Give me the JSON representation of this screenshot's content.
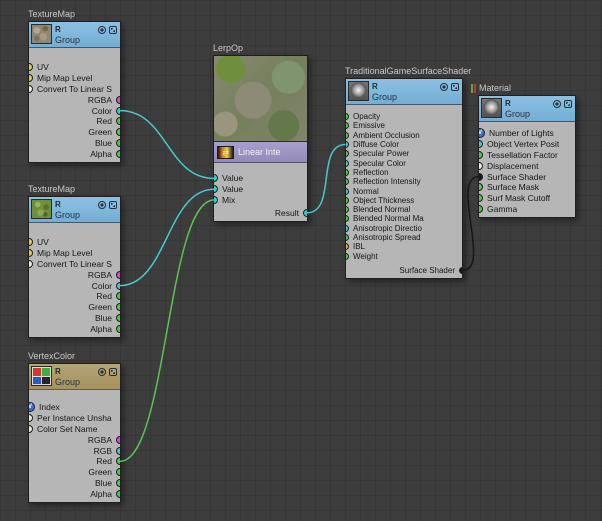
{
  "canvas": {
    "background": "#3d3d3d"
  },
  "nodes": {
    "tm1": {
      "title": "TextureMap",
      "badge": "R",
      "group_label": "Group",
      "inputs": [
        {
          "label": "UV",
          "color": "#e2cf3a"
        },
        {
          "label": "Mip Map Level",
          "color": "#e2cf3a"
        },
        {
          "label": "Convert To Linear S",
          "color": "#efe8d4"
        }
      ],
      "outputs": [
        {
          "label": "RGBA",
          "color": "#de48de"
        },
        {
          "label": "Color",
          "color": "#3ecaca"
        },
        {
          "label": "Red",
          "color": "#46cf46"
        },
        {
          "label": "Green",
          "color": "#46cf46"
        },
        {
          "label": "Blue",
          "color": "#46cf46"
        },
        {
          "label": "Alpha",
          "color": "#46cf46"
        }
      ]
    },
    "tm2": {
      "title": "TextureMap",
      "badge": "R",
      "group_label": "Group",
      "inputs": [
        {
          "label": "UV",
          "color": "#e2cf3a"
        },
        {
          "label": "Mip Map Level",
          "color": "#e2cf3a"
        },
        {
          "label": "Convert To Linear S",
          "color": "#efe8d4"
        }
      ],
      "outputs": [
        {
          "label": "RGBA",
          "color": "#de48de"
        },
        {
          "label": "Color",
          "color": "#3ecaca"
        },
        {
          "label": "Red",
          "color": "#46cf46"
        },
        {
          "label": "Green",
          "color": "#46cf46"
        },
        {
          "label": "Blue",
          "color": "#46cf46"
        },
        {
          "label": "Alpha",
          "color": "#46cf46"
        }
      ]
    },
    "vc": {
      "title": "VertexColor",
      "badge": "R",
      "group_label": "Group",
      "inputs": [
        {
          "label": "Index",
          "color": "#3f6fd9",
          "badge": "V"
        },
        {
          "label": "Per Instance Unsha",
          "color": "#efe8d4"
        },
        {
          "label": "Color Set Name",
          "color": "#efe8d4"
        }
      ],
      "outputs": [
        {
          "label": "RGBA",
          "color": "#de48de"
        },
        {
          "label": "RGB",
          "color": "#3ecaca"
        },
        {
          "label": "Red",
          "color": "#46cf46"
        },
        {
          "label": "Green",
          "color": "#46cf46"
        },
        {
          "label": "Blue",
          "color": "#46cf46"
        },
        {
          "label": "Alpha",
          "color": "#46cf46"
        }
      ]
    },
    "lerp": {
      "title": "LerpOp",
      "header_label": "Linear Inte",
      "inputs": [
        {
          "label": "Value",
          "color": "#3ecaca"
        },
        {
          "label": "Value",
          "color": "#3ecaca"
        },
        {
          "label": "Mix",
          "color": "#3ecaca"
        }
      ],
      "outputs": [
        {
          "label": "Result",
          "color": "#3ecaca"
        }
      ]
    },
    "surface": {
      "title": "TraditionalGameSurfaceShader",
      "badge": "R",
      "group_label": "Group",
      "inputs": [
        {
          "label": "Opacity",
          "color": "#46cf46"
        },
        {
          "label": "Emissive",
          "color": "#46cf46"
        },
        {
          "label": "Ambient Occlusion",
          "color": "#46cf46"
        },
        {
          "label": "Diffuse Color",
          "color": "#3ecaca"
        },
        {
          "label": "Specular Power",
          "color": "#46cf46"
        },
        {
          "label": "Specular Color",
          "color": "#3ecaca"
        },
        {
          "label": "Reflection",
          "color": "#46cf46"
        },
        {
          "label": "Reflection Intensity",
          "color": "#46cf46"
        },
        {
          "label": "Normal",
          "color": "#3ecaca"
        },
        {
          "label": "Object Thickness",
          "color": "#46cf46"
        },
        {
          "label": "Blended Normal",
          "color": "#46cf46"
        },
        {
          "label": "Blended Normal Ma",
          "color": "#46cf46"
        },
        {
          "label": "Anisotropic Directio",
          "color": "#3ecaca"
        },
        {
          "label": "Anisotropic Spread",
          "color": "#46cf46"
        },
        {
          "label": "IBL",
          "color": "#eda73b"
        },
        {
          "label": "Weight",
          "color": "#46cf46"
        }
      ],
      "outputs": [
        {
          "label": "Surface Shader",
          "color": "#1b1b1b"
        }
      ]
    },
    "material": {
      "title": "Material",
      "badge": "R",
      "group_label": "Group",
      "inputs": [
        {
          "label": "Number of Lights",
          "color": "#3f6fd9",
          "badge": "V"
        },
        {
          "label": "Object Vertex Posit",
          "color": "#3ecaca"
        },
        {
          "label": "Tessellation Factor",
          "color": "#46cf46"
        },
        {
          "label": "Displacement",
          "color": "#efe8d4"
        },
        {
          "label": "Surface Shader",
          "color": "#1b1b1b"
        },
        {
          "label": "Surface Mask",
          "color": "#46cf46"
        },
        {
          "label": "Surf Mask Cutoff",
          "color": "#46cf46"
        },
        {
          "label": "Gamma",
          "color": "#46cf46"
        }
      ],
      "outputs": []
    }
  },
  "connections": [
    {
      "name": "texturemap1-color-to-lerp-value1",
      "from": "nodes.tm1.outputs.1",
      "to": "nodes.lerp.inputs.0",
      "color": "#49c9c9"
    },
    {
      "name": "texturemap2-color-to-lerp-value2",
      "from": "nodes.tm2.outputs.1",
      "to": "nodes.lerp.inputs.1",
      "color": "#49c9c9"
    },
    {
      "name": "vertexcolor-red-to-lerp-mix",
      "from": "nodes.vc.outputs.2",
      "to": "nodes.lerp.inputs.2",
      "color": "#5cc353"
    },
    {
      "name": "lerp-result-to-diffuse-color",
      "from": "nodes.lerp.outputs.0",
      "to": "nodes.surface.inputs.3",
      "color": "#49c9c9"
    },
    {
      "name": "surface-shader-to-material",
      "from": "nodes.surface.outputs.0",
      "to": "nodes.material.inputs.4",
      "color": "#161616"
    }
  ]
}
